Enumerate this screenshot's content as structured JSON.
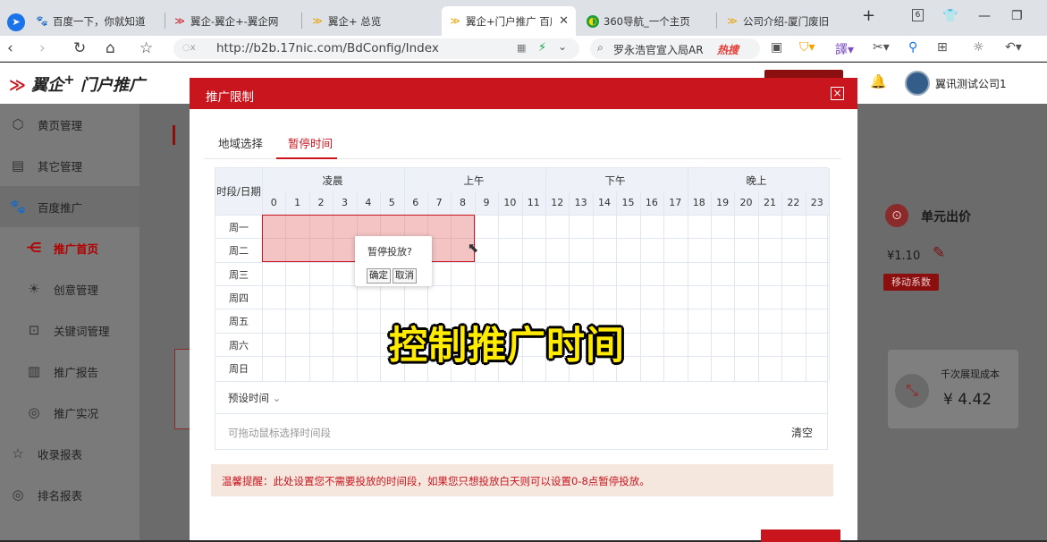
{
  "browser": {
    "tabs": [
      {
        "label": "百度一下，你就知道",
        "icon": "paw-icon"
      },
      {
        "label": "翼企-翼企+-翼企网",
        "icon": "yiqi-logo-icon"
      },
      {
        "label": "翼企+ 总览",
        "icon": "yiqi-logo-icon"
      },
      {
        "label": "翼企+门户推广 百度",
        "icon": "yiqi-logo-icon",
        "active": true
      },
      {
        "label": "360导航_一个主页",
        "icon": "360-icon"
      },
      {
        "label": "公司介绍-厦门废旧",
        "icon": "yiqi-logo-icon"
      }
    ],
    "new_tab": "+",
    "tab_count": "6",
    "url": "http://b2b.17nic.com/BdConfig/Index",
    "search_text": "罗永浩官宣入局AR",
    "hot_search": "热搜"
  },
  "app": {
    "logo_text": "翼企",
    "logo_sup": "+",
    "logo_suffix": "门户推广",
    "username": "翼讯测试公司1"
  },
  "sidebar": {
    "items": [
      {
        "label": "黄页管理",
        "icon": "cube-icon",
        "level": "top"
      },
      {
        "label": "其它管理",
        "icon": "document-icon",
        "level": "top"
      },
      {
        "label": "百度推广",
        "icon": "paw-icon",
        "level": "top"
      },
      {
        "label": "推广首页",
        "icon": "share-icon",
        "level": "sub",
        "active": true
      },
      {
        "label": "创意管理",
        "icon": "bulb-icon",
        "level": "sub"
      },
      {
        "label": "关键词管理",
        "icon": "search-icon",
        "level": "sub"
      },
      {
        "label": "推广报告",
        "icon": "clipboard-icon",
        "level": "sub"
      },
      {
        "label": "推广实况",
        "icon": "target-icon",
        "level": "sub"
      },
      {
        "label": "收录报表",
        "icon": "star-icon",
        "level": "top"
      },
      {
        "label": "排名报表",
        "icon": "target-icon",
        "level": "top"
      }
    ]
  },
  "cards": {
    "unit_price_title": "单元出价",
    "unit_price_value": "¥1.10",
    "mobile_coef": "移动系数",
    "cpm_title": "千次展现成本",
    "cpm_value": "¥  4.42"
  },
  "modal": {
    "title": "推广限制",
    "close": "×",
    "tabs": [
      "地域选择",
      "暂停时间"
    ],
    "active_tab": 1,
    "grid": {
      "corner": "时段/日期",
      "periods": [
        "凌晨",
        "上午",
        "下午",
        "晚上"
      ],
      "hours": [
        "0",
        "1",
        "2",
        "3",
        "4",
        "5",
        "6",
        "7",
        "8",
        "9",
        "10",
        "11",
        "12",
        "13",
        "14",
        "15",
        "16",
        "17",
        "18",
        "19",
        "20",
        "21",
        "22",
        "23"
      ],
      "days": [
        "周一",
        "周二",
        "周三",
        "周四",
        "周五",
        "周六",
        "周日"
      ],
      "selected_days": [
        "周一",
        "周二"
      ],
      "selected_hours": [
        "0",
        "1",
        "2",
        "3",
        "4",
        "5",
        "6",
        "7",
        "8"
      ]
    },
    "popup": {
      "title": "暂停投放?",
      "confirm": "确定",
      "cancel": "取消"
    },
    "preset_label": "预设时间",
    "drag_hint": "可拖动鼠标选择时间段",
    "clear": "清空",
    "tip": "温馨提醒：此处设置您不需要投放的时间段，如果您只想投放白天则可以设置0-8点暂停投放。"
  },
  "overlay_caption": "控制推广时间"
}
